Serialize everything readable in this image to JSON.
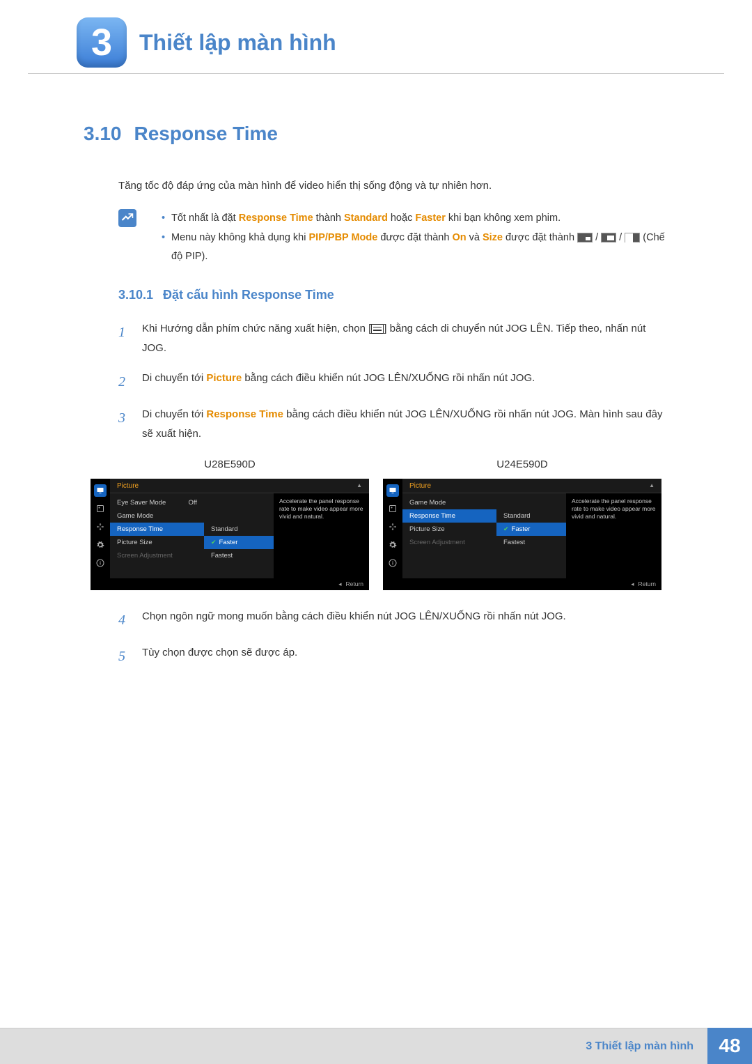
{
  "chapter": {
    "number": "3",
    "title": "Thiết lập màn hình"
  },
  "section": {
    "number": "3.10",
    "title": "Response Time"
  },
  "intro": "Tăng tốc độ đáp ứng của màn hình để video hiển thị sống động và tự nhiên hơn.",
  "notes": {
    "n1_a": "Tốt nhất là đặt ",
    "n1_rt": "Response Time",
    "n1_b": " thành ",
    "n1_std": "Standard",
    "n1_c": " hoặc ",
    "n1_fast": "Faster",
    "n1_d": " khi bạn không xem phim.",
    "n2_a": "Menu này không khả dụng khi ",
    "n2_pip": "PIP/PBP Mode",
    "n2_b": " được đặt thành ",
    "n2_on": "On",
    "n2_c": " và ",
    "n2_size": "Size",
    "n2_d": " được đặt thành ",
    "n2_end": " (Chế độ PIP)."
  },
  "subsection": {
    "number": "3.10.1",
    "title": "Đặt cấu hình Response Time"
  },
  "steps": {
    "s1a": "Khi Hướng dẫn phím chức năng xuất hiện, chọn [",
    "s1b": "] bằng cách di chuyển nút JOG LÊN. Tiếp theo, nhấn nút JOG.",
    "s2a": "Di chuyển tới ",
    "s2pic": "Picture",
    "s2b": " bằng cách điều khiển nút JOG LÊN/XUỐNG rồi nhấn nút JOG.",
    "s3a": "Di chuyển tới ",
    "s3rt": "Response Time",
    "s3b": " bằng cách điều khiển nút JOG LÊN/XUỐNG rồi nhấn nút JOG. Màn hình sau đây sẽ xuất hiện.",
    "s4": "Chọn ngôn ngữ mong muốn bằng cách điều khiển nút JOG LÊN/XUỐNG rồi nhấn nút JOG.",
    "s5": "Tùy chọn được chọn sẽ được áp."
  },
  "osd": {
    "models": {
      "a": "U28E590D",
      "b": "U24E590D"
    },
    "header": "Picture",
    "help": "Accelerate the panel response rate to make video appear more vivid and natural.",
    "return": "Return",
    "opts": {
      "std": "Standard",
      "faster": "Faster",
      "fastest": "Fastest"
    },
    "off": "Off",
    "menuA": {
      "i1": "Eye Saver Mode",
      "i2": "Game Mode",
      "i3": "Response Time",
      "i4": "Picture Size",
      "i5": "Screen Adjustment"
    },
    "menuB": {
      "i1": "Game Mode",
      "i2": "Response Time",
      "i3": "Picture Size",
      "i4": "Screen Adjustment"
    }
  },
  "footer": {
    "text": "3 Thiết lập màn hình",
    "page": "48"
  }
}
